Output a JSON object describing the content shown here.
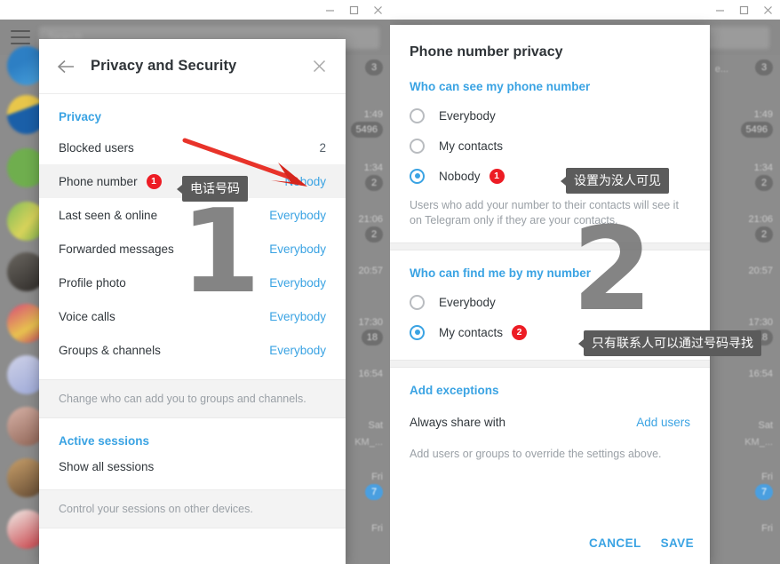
{
  "window_controls": {
    "minimize": "minimize-icon",
    "maximize": "maximize-icon",
    "close": "close-icon"
  },
  "background": {
    "menu_icon": "hamburger-menu-icon",
    "search_placeholder": "Search",
    "chats": [
      {
        "snippet": "e...",
        "time": "",
        "badge": "3"
      },
      {
        "snippet": "",
        "time": "1:49",
        "badge": "5496"
      },
      {
        "snippet": "",
        "time": "1:34",
        "badge": "2"
      },
      {
        "snippet": "",
        "time": "21:06",
        "badge": "2"
      },
      {
        "snippet": "",
        "time": "20:57",
        "badge": ""
      },
      {
        "snippet": "",
        "time": "17:30",
        "badge": "18"
      },
      {
        "snippet": "",
        "time": "16:54",
        "badge": ""
      },
      {
        "snippet": "KM_...",
        "time": "Sat",
        "badge": ""
      },
      {
        "snippet": "...",
        "time": "Fri",
        "badge": "7"
      },
      {
        "snippet": "",
        "time": "Fri",
        "badge": ""
      }
    ]
  },
  "left_dialog": {
    "back_icon": "back-arrow-icon",
    "title": "Privacy and Security",
    "close_icon": "close-icon",
    "privacy_heading": "Privacy",
    "rows": [
      {
        "label": "Blocked users",
        "value": "2",
        "value_style": "plain"
      },
      {
        "label": "Phone number",
        "value": "Nobody",
        "value_style": "link",
        "highlight": true,
        "badge": "1"
      },
      {
        "label": "Last seen & online",
        "value": "Everybody",
        "value_style": "link"
      },
      {
        "label": "Forwarded messages",
        "value": "Everybody",
        "value_style": "link"
      },
      {
        "label": "Profile photo",
        "value": "Everybody",
        "value_style": "link"
      },
      {
        "label": "Voice calls",
        "value": "Everybody",
        "value_style": "link"
      },
      {
        "label": "Groups & channels",
        "value": "Everybody",
        "value_style": "link"
      }
    ],
    "hint": "Change who can add you to groups and channels.",
    "sessions_link": "Active sessions",
    "sessions_row": "Show all sessions",
    "sessions_hint": "Control your sessions on other devices.",
    "tooltip": "电话号码",
    "step_number": "1"
  },
  "right_dialog": {
    "title": "Phone number privacy",
    "section1": {
      "heading": "Who can see my phone number",
      "options": [
        {
          "label": "Everybody",
          "selected": false
        },
        {
          "label": "My contacts",
          "selected": false
        },
        {
          "label": "Nobody",
          "selected": true,
          "badge": "1",
          "tooltip": "设置为没人可见"
        }
      ],
      "description": "Users who add your number to their contacts will see it on Telegram only if they are your contacts."
    },
    "section2": {
      "heading": "Who can find me by my number",
      "options": [
        {
          "label": "Everybody",
          "selected": false
        },
        {
          "label": "My contacts",
          "selected": true,
          "badge": "2",
          "tooltip": "只有联系人可以通过号码寻找"
        }
      ]
    },
    "exceptions": {
      "heading": "Add exceptions",
      "row_label": "Always share with",
      "row_action": "Add users",
      "hint": "Add users or groups to override the settings above."
    },
    "cancel_label": "CANCEL",
    "save_label": "SAVE",
    "step_number": "2"
  },
  "colors": {
    "accent_blue": "#3aa3e3",
    "badge_red": "#ed1c24",
    "tooltip_grey": "#5b5b5b",
    "watermark_grey": "#6e6e6e"
  }
}
